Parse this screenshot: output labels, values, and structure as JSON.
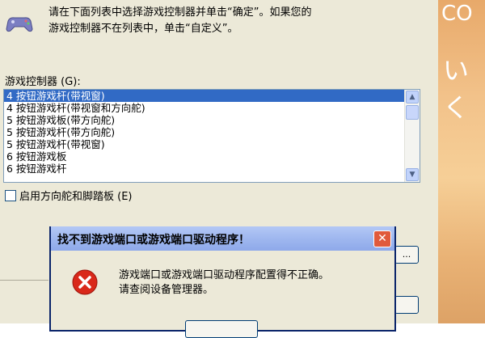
{
  "dialog": {
    "instructions_line1": "请在下面列表中选择游戏控制器并单击“确定”。如果您的",
    "instructions_line2": "游戏控制器不在列表中，单击“自定义”。",
    "list_label": "游戏控制器 (G):",
    "controllers": [
      "4 按钮游戏杆(带视窗)",
      "4 按钮游戏杆(带视窗和方向舵)",
      "5 按钮游戏板(带方向舵)",
      "5 按钮游戏杆(带方向舵)",
      "5 按钮游戏杆(带视窗)",
      "6 按钮游戏板",
      "6 按钮游戏杆"
    ],
    "selected_index": 0,
    "rudder_checkbox_label": "启用方向舵和脚踏板 (E)",
    "rudder_checked": false,
    "side_button_label": "..."
  },
  "background": {
    "text1": "CO",
    "text2": "いく"
  },
  "error_dialog": {
    "title": "找不到游戏端口或游戏端口驱动程序！",
    "message_line1": "游戏端口或游戏端口驱动程序配置得不正确。",
    "message_line2": "请查阅设备管理器。",
    "close_glyph": "✕"
  }
}
